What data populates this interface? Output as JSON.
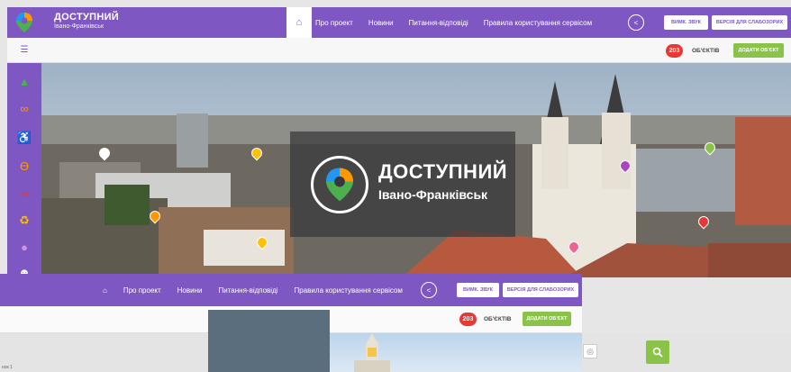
{
  "header": {
    "brand_title": "ДОСТУПНИЙ",
    "brand_subtitle": "Івано-Франківськ",
    "home_icon": "home-icon",
    "nav": [
      "Про проект",
      "Новини",
      "Питання-відповіді",
      "Правила користування сервісом"
    ],
    "share_icon": "share-icon",
    "sound_button": "ВИМК. ЗВУК",
    "accessibility_button": "ВЕРСІЯ ДЛЯ СЛАБОЗОРИХ"
  },
  "subbar": {
    "filter_icon": "sliders-icon",
    "count": "203",
    "count_label": "ОБ'ЄКТІВ",
    "add_button": "ДОДАТИ ОБ'ЄКТ"
  },
  "sidebar": {
    "icons": [
      "map-icon",
      "glasses-icon",
      "wheelchair-icon",
      "ear-icon",
      "bicycle-icon",
      "stroller-icon",
      "head-icon",
      "person-icon"
    ]
  },
  "hero": {
    "title": "ДОСТУПНИЙ",
    "subtitle": "Івано-Франківськ"
  },
  "overlay_window": {
    "home_icon": "home-icon",
    "nav": [
      "Про проект",
      "Новини",
      "Питання-відповіді",
      "Правила користування сервісом"
    ],
    "sound_button": "ВИМК. ЗВУК",
    "accessibility_button": "ВЕРСІЯ ДЛЯ СЛАБОЗОРИХ",
    "count": "203",
    "count_label": "ОБ'ЄКТІВ",
    "add_button": "ДОДАТИ ОБ'ЄКТ",
    "search_icon": "search-icon",
    "caption": "нок 1"
  },
  "colors": {
    "brand": "#7e57c2",
    "accent_green": "#8bc34a",
    "badge_red": "#e53935"
  }
}
